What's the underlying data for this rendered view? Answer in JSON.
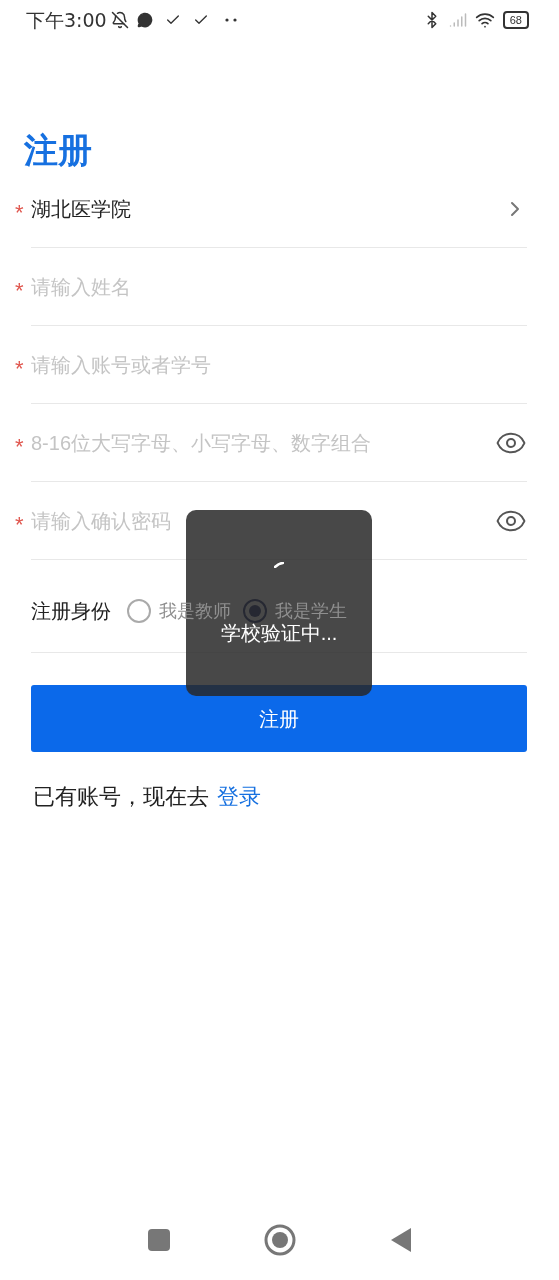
{
  "status_bar": {
    "time": "下午3:00",
    "battery": "68"
  },
  "title": "注册",
  "fields": [
    {
      "kind": "select",
      "required_mark": "*",
      "value": "湖北医学院"
    },
    {
      "kind": "text",
      "required_mark": "*",
      "placeholder": "请输入姓名"
    },
    {
      "kind": "text",
      "required_mark": "*",
      "placeholder": "请输入账号或者学号"
    },
    {
      "kind": "password",
      "required_mark": "*",
      "placeholder": "8-16位大写字母、小写字母、数字组合"
    },
    {
      "kind": "password",
      "required_mark": "*",
      "placeholder": "请输入确认密码"
    }
  ],
  "identity": {
    "label": "注册身份",
    "options": [
      {
        "label": "我是教师",
        "selected": false
      },
      {
        "label": "我是学生",
        "selected": true
      }
    ]
  },
  "register_button": "注册",
  "login_prompt": {
    "text": "已有账号，现在去",
    "link": "登录"
  },
  "toast": {
    "text": "学校验证中..."
  }
}
